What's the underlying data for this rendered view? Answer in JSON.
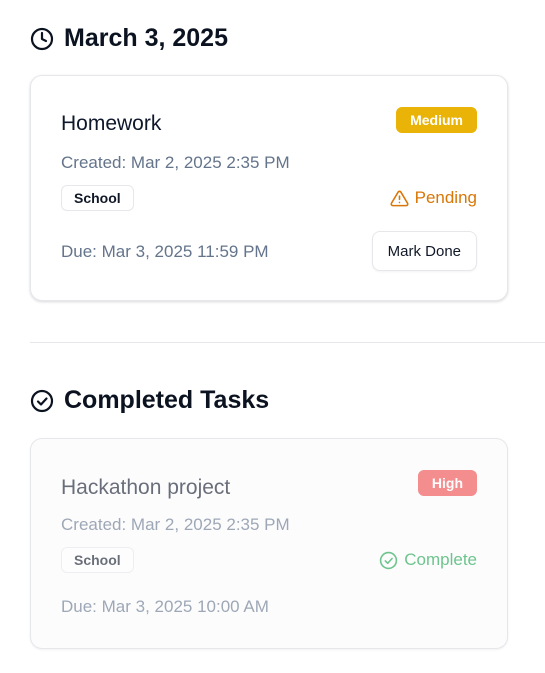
{
  "date_section": {
    "icon": "clock-icon",
    "title": "March 3, 2025"
  },
  "pending_task": {
    "title": "Homework",
    "priority": "Medium",
    "priority_color": "#eab308",
    "created": "Created: Mar 2, 2025 2:35 PM",
    "tag": "School",
    "status_icon": "warning-triangle-icon",
    "status": "Pending",
    "status_color": "#d97706",
    "due": "Due: Mar 3, 2025 11:59 PM",
    "action_label": "Mark Done"
  },
  "completed_section": {
    "icon": "check-circle-icon",
    "title": "Completed Tasks"
  },
  "completed_task": {
    "title": "Hackathon project",
    "priority": "High",
    "priority_color": "#ef4444",
    "created": "Created: Mar 2, 2025 2:35 PM",
    "tag": "School",
    "status_icon": "check-circle-icon",
    "status": "Complete",
    "status_color": "#16a34a",
    "due": "Due: Mar 3, 2025 10:00 AM"
  }
}
